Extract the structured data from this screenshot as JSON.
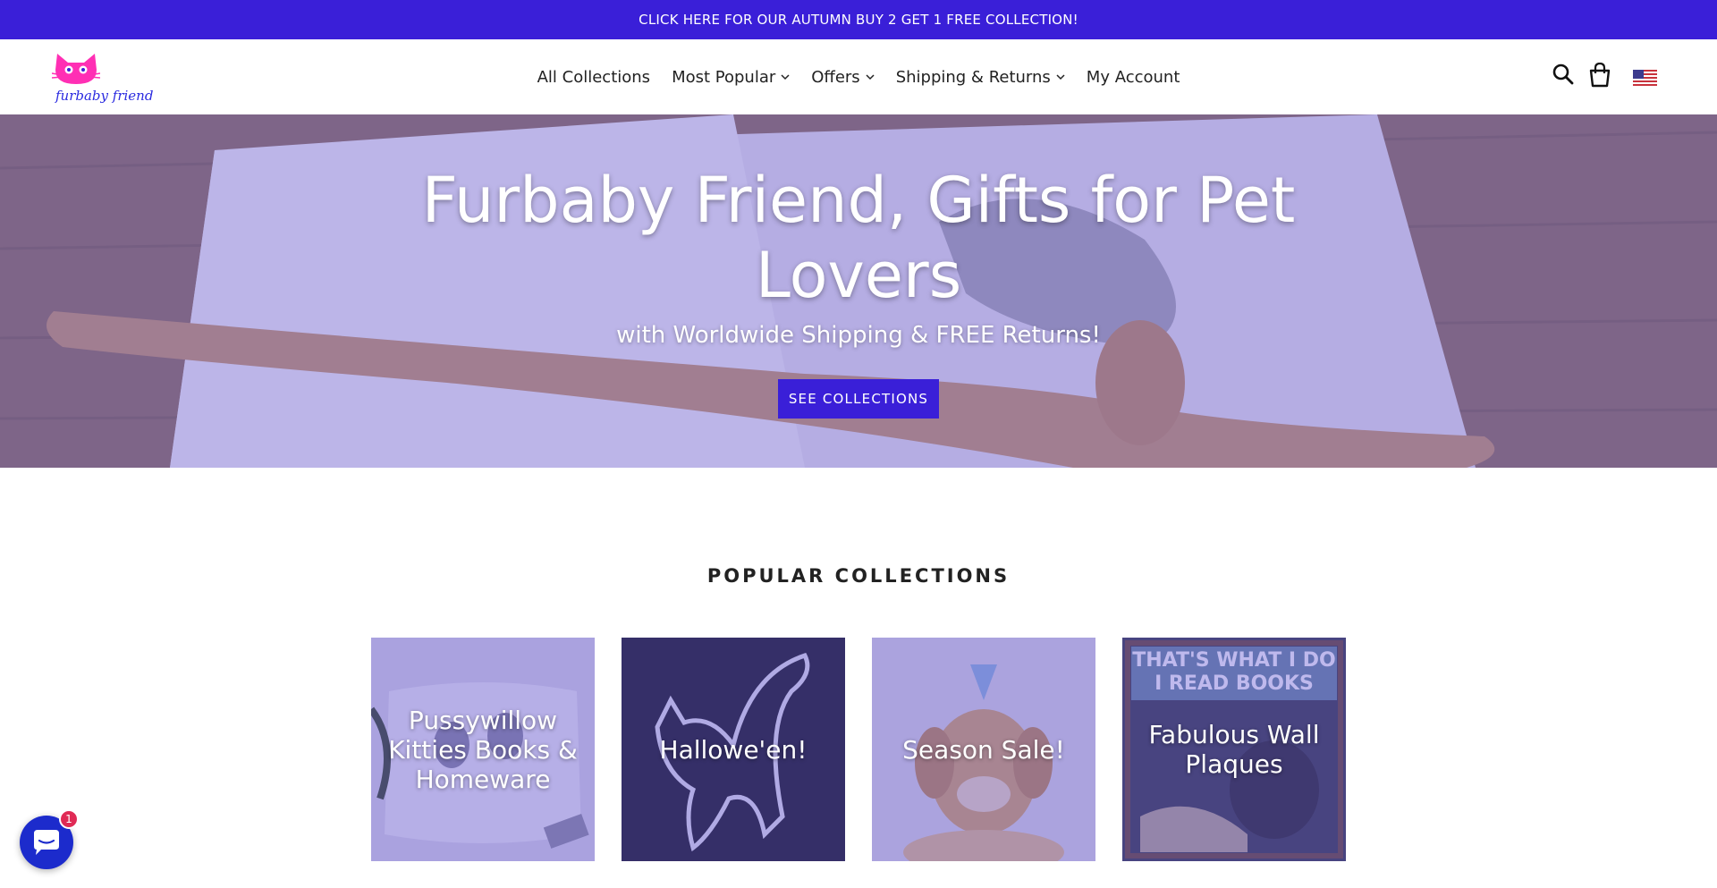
{
  "announcement": {
    "text": "CLICK HERE FOR OUR AUTUMN BUY 2 GET 1 FREE COLLECTION!"
  },
  "logo": {
    "text": "furbaby friend"
  },
  "nav": {
    "items": [
      {
        "label": "All Collections",
        "has_dropdown": false
      },
      {
        "label": "Most Popular",
        "has_dropdown": true
      },
      {
        "label": "Offers",
        "has_dropdown": true
      },
      {
        "label": "Shipping & Returns",
        "has_dropdown": true
      },
      {
        "label": "My Account",
        "has_dropdown": false
      }
    ]
  },
  "header_icons": [
    "search-icon",
    "cart-icon",
    "us-flag-icon"
  ],
  "hero": {
    "title": "Furbaby Friend, Gifts for Pet Lovers",
    "subtitle": "with Worldwide Shipping & FREE Returns!",
    "button_label": "SEE COLLECTIONS"
  },
  "popular": {
    "title": "POPULAR COLLECTIONS",
    "collections": [
      {
        "label": "Pussywillow Kitties Books & Homeware"
      },
      {
        "label": "Hallowe'en!"
      },
      {
        "label": "Season Sale!"
      },
      {
        "label": "Fabulous Wall Plaques"
      }
    ]
  },
  "chat": {
    "badge": "1"
  },
  "colors": {
    "accent": "#3a1fd8",
    "logo_pink": "#ff2fb4",
    "logo_blue": "#2b2be0",
    "badge_red": "#e02a55"
  }
}
